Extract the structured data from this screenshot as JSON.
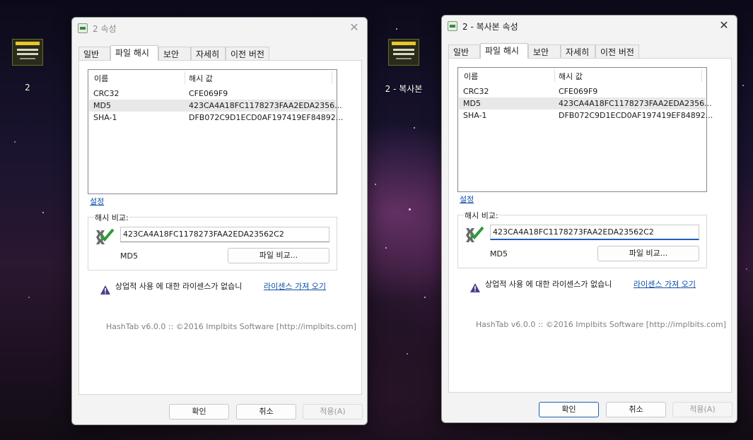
{
  "desktop_icons": [
    {
      "label": "2"
    },
    {
      "label": "2 - 복사본"
    }
  ],
  "dialogs": [
    {
      "title": "2 속성",
      "tabs": [
        "일반",
        "파일 해시",
        "보안",
        "자세히",
        "이전 버전"
      ],
      "active_tab": "파일 해시",
      "columns": [
        "이름",
        "해시 값"
      ],
      "rows": [
        {
          "name": "CRC32",
          "value": "CFE069F9"
        },
        {
          "name": "MD5",
          "value": "423CA4A18FC1178273FAA2EDA2356..."
        },
        {
          "name": "SHA-1",
          "value": "DFB072C9D1ECD0AF197419EF84892..."
        }
      ],
      "settings_link": "설정",
      "compare_label": "해시 비교:",
      "compare_value": "423CA4A18FC1178273FAA2EDA23562C2",
      "algo": "MD5",
      "compare_file_button": "파일 비교...",
      "license_warning": "상업적 사용 에 대한 라이센스가 없습니",
      "license_link": "라이센스 가져 오기",
      "footer": "HashTab v6.0.0 :: ©2016 Implbits Software [http://implbits.com]",
      "ok": "확인",
      "cancel": "취소",
      "apply": "적용(A)"
    },
    {
      "title": "2 - 복사본 속성",
      "tabs": [
        "일반",
        "파일 해시",
        "보안",
        "자세히",
        "이전 버전"
      ],
      "active_tab": "파일 해시",
      "columns": [
        "이름",
        "해시 값"
      ],
      "rows": [
        {
          "name": "CRC32",
          "value": "CFE069F9"
        },
        {
          "name": "MD5",
          "value": "423CA4A18FC1178273FAA2EDA2356..."
        },
        {
          "name": "SHA-1",
          "value": "DFB072C9D1ECD0AF197419EF84892..."
        }
      ],
      "settings_link": "설정",
      "compare_label": "해시 비교:",
      "compare_value": "423CA4A18FC1178273FAA2EDA23562C2",
      "algo": "MD5",
      "compare_file_button": "파일 비교...",
      "license_warning": "상업적 사용 에 대한 라이센스가 없습니",
      "license_link": "라이센스 가져 오기",
      "footer": "HashTab v6.0.0 :: ©2016 Implbits Software [http://implbits.com]",
      "ok": "확인",
      "cancel": "취소",
      "apply": "적용(A)"
    }
  ],
  "colors": {
    "accent": "#1f5fb8",
    "link": "#0b4fa8",
    "warning": "#4b3f8a",
    "check_green": "#2e9a3a"
  }
}
